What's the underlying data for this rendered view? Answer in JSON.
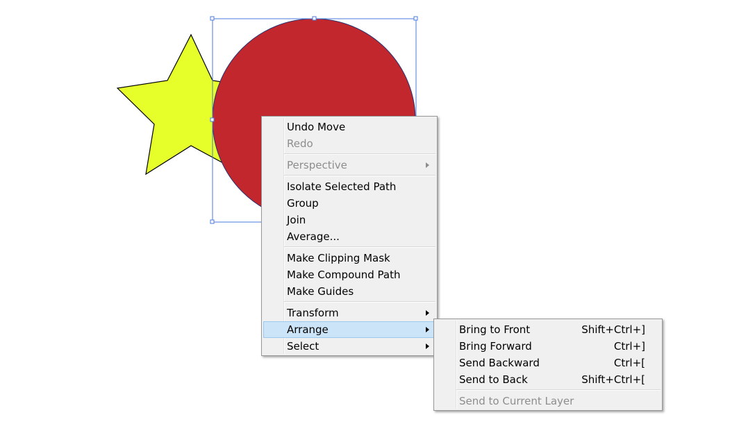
{
  "context_menu": {
    "undo_move": "Undo Move",
    "redo": "Redo",
    "perspective": "Perspective",
    "isolate_selected_path": "Isolate Selected Path",
    "group": "Group",
    "join": "Join",
    "average": "Average...",
    "make_clipping_mask": "Make Clipping Mask",
    "make_compound_path": "Make Compound Path",
    "make_guides": "Make Guides",
    "transform": "Transform",
    "arrange": "Arrange",
    "select": "Select"
  },
  "arrange_submenu": {
    "items": [
      {
        "label": "Bring to Front",
        "shortcut": "Shift+Ctrl+]"
      },
      {
        "label": "Bring Forward",
        "shortcut": "Ctrl+]"
      },
      {
        "label": "Send Backward",
        "shortcut": "Ctrl+["
      },
      {
        "label": "Send to Back",
        "shortcut": "Shift+Ctrl+["
      }
    ],
    "send_to_current_layer": "Send to Current Layer"
  },
  "colors": {
    "star_fill": "#e6ff2b",
    "circle_fill": "#c1272d",
    "selection_color": "#4a7bde",
    "menu_highlight": "#cce4f7",
    "disabled_text": "#8d8d8d"
  }
}
